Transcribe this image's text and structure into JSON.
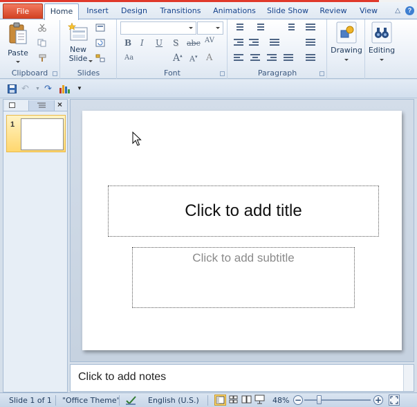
{
  "tabs": [
    "File",
    "Home",
    "Insert",
    "Design",
    "Transitions",
    "Animations",
    "Slide Show",
    "Review",
    "View"
  ],
  "active_tab": "Home",
  "ribbon": {
    "clipboard": {
      "label": "Clipboard",
      "paste": "Paste"
    },
    "slides": {
      "label": "Slides",
      "new_slide_line1": "New",
      "new_slide_line2": "Slide"
    },
    "font": {
      "label": "Font",
      "font_name": "",
      "font_size": ""
    },
    "paragraph": {
      "label": "Paragraph"
    },
    "drawing": {
      "label": "Drawing"
    },
    "editing": {
      "label": "Editing"
    }
  },
  "left_panel": {
    "slide_number": "1"
  },
  "slide": {
    "title_placeholder": "Click to add title",
    "subtitle_placeholder": "Click to add subtitle"
  },
  "notes": {
    "placeholder": "Click to add notes"
  },
  "status": {
    "slide_info": "Slide 1 of 1",
    "theme": "\"Office Theme\"",
    "language": "English (U.S.)",
    "zoom": "48%",
    "zoom_minus": "−",
    "zoom_plus": "+"
  },
  "colors": {
    "file_tab": "#cf3d1d",
    "accent": "#15428b",
    "thumb_selected": "#ffd76e"
  }
}
